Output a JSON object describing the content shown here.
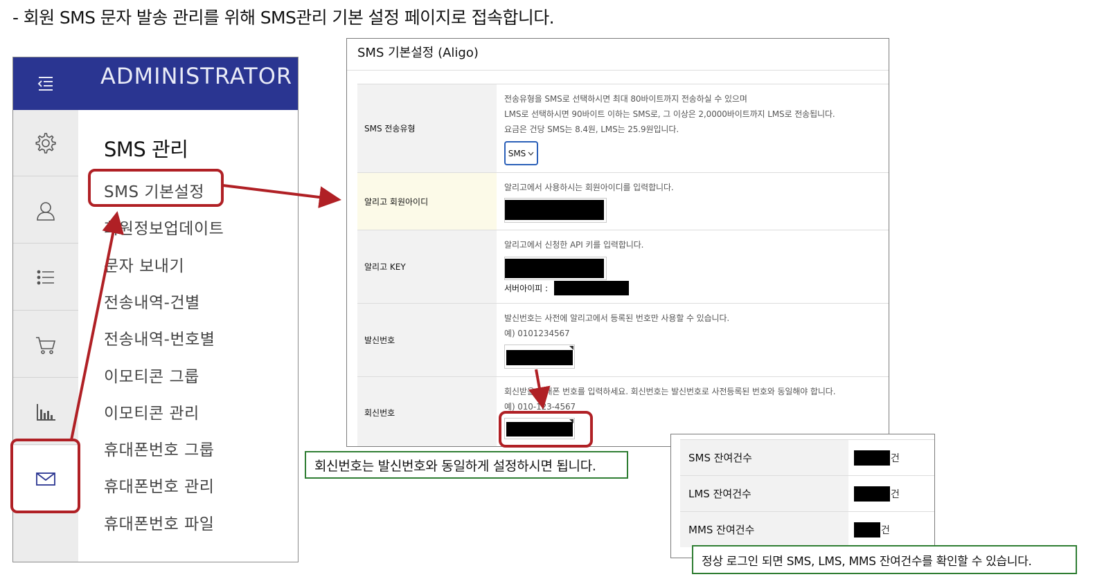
{
  "intro": "- 회원 SMS 문자 발송 관리를 위해 SMS관리 기본 설정 페이지로 접속합니다.",
  "admin": {
    "title": "ADMINISTRATOR",
    "menu_title": "SMS 관리",
    "menu_items": [
      "SMS 기본설정",
      "회원정보업데이트",
      "문자 보내기",
      "전송내역-건별",
      "전송내역-번호별",
      "이모티콘 그룹",
      "이모티콘 관리",
      "휴대폰번호 그룹",
      "휴대폰번호 관리",
      "휴대폰번호 파일"
    ],
    "rail_icons": [
      "hamburger-menu-icon",
      "gear-icon",
      "user-icon",
      "list-icon",
      "cart-icon",
      "bar-chart-icon",
      "mail-icon"
    ],
    "active_rail_icon": "mail-icon"
  },
  "settings": {
    "title": "SMS 기본설정 (Aligo)",
    "rows": {
      "send_type": {
        "label": "SMS 전송유형",
        "desc1": "전송유형을 SMS로 선택하시면 최대 80바이트까지 전송하실 수 있으며",
        "desc2": "LMS로 선택하시면 90바이트 이하는 SMS로, 그 이상은 2,0000바이트까지 LMS로 전송됩니다.",
        "desc3": "요금은 건당 SMS는 8.4원, LMS는 25.9원입니다.",
        "select_value": "SMS"
      },
      "member_id": {
        "label": "알리고 회원아이디",
        "desc": "알리고에서 사용하시는 회원아이디를 입력합니다."
      },
      "key": {
        "label": "알리고 KEY",
        "desc": "알리고에서 신청한 API 키를 입력합니다.",
        "server_ip_label": "서버아이피 :"
      },
      "sender": {
        "label": "발신번호",
        "desc": "발신번호는 사전에 알리고에서 등록된 번호만 사용할 수 있습니다.",
        "example": "예) 0101234567"
      },
      "reply": {
        "label": "회신번호",
        "desc": "회신받을 휴대폰 번호를 입력하세요. 회신번호는 발신번호로 사전등록된 번호와 동일해야 합니다.",
        "example": "예) 010-123-4567"
      }
    }
  },
  "balance": {
    "unit": "건",
    "rows": [
      {
        "label": "SMS 잔여건수"
      },
      {
        "label": "LMS 잔여건수"
      },
      {
        "label": "MMS 잔여건수"
      }
    ]
  },
  "notes": {
    "reply_note": "회신번호는 발신번호와 동일하게 설정하시면 됩니다.",
    "balance_note": "정상 로그인 되면 SMS, LMS, MMS 잔여건수를 확인할 수 있습니다."
  },
  "colors": {
    "admin_header": "#2a3591",
    "highlight": "#b02025",
    "note_border": "#2e7d32",
    "select_border": "#2a5fb8"
  }
}
